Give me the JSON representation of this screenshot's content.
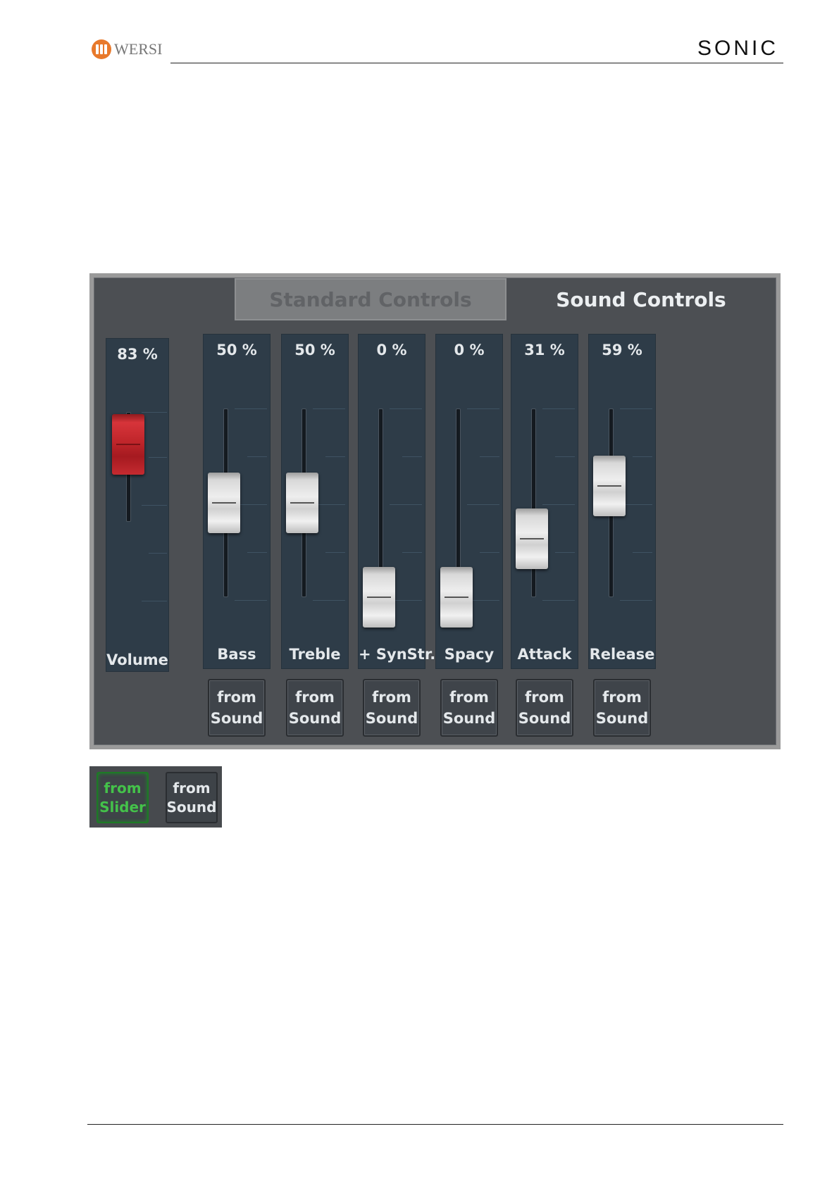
{
  "header": {
    "brand": "WERSI",
    "product": "SONIC"
  },
  "tabs": {
    "standard": "Standard Controls",
    "sound": "Sound Controls",
    "active": "sound"
  },
  "volume": {
    "percent": "83 %",
    "label": "Volume",
    "level": 0.83,
    "color": "#c0262b"
  },
  "sliders": [
    {
      "percent": "50 %",
      "label": "Bass",
      "level": 0.5,
      "button": [
        "from",
        "Sound"
      ]
    },
    {
      "percent": "50 %",
      "label": "Treble",
      "level": 0.5,
      "button": [
        "from",
        "Sound"
      ]
    },
    {
      "percent": "0 %",
      "label": "+ SynStr.",
      "level": 0.0,
      "button": [
        "from",
        "Sound"
      ]
    },
    {
      "percent": "0 %",
      "label": "Spacy",
      "level": 0.0,
      "button": [
        "from",
        "Sound"
      ]
    },
    {
      "percent": "31 %",
      "label": "Attack",
      "level": 0.31,
      "button": [
        "from",
        "Sound"
      ]
    },
    {
      "percent": "59 %",
      "label": "Release",
      "level": 0.59,
      "button": [
        "from",
        "Sound"
      ]
    }
  ],
  "legend": {
    "slider_button": [
      "from",
      "Slider"
    ],
    "sound_button": [
      "from",
      "Sound"
    ],
    "active_color": "#44c24a"
  }
}
